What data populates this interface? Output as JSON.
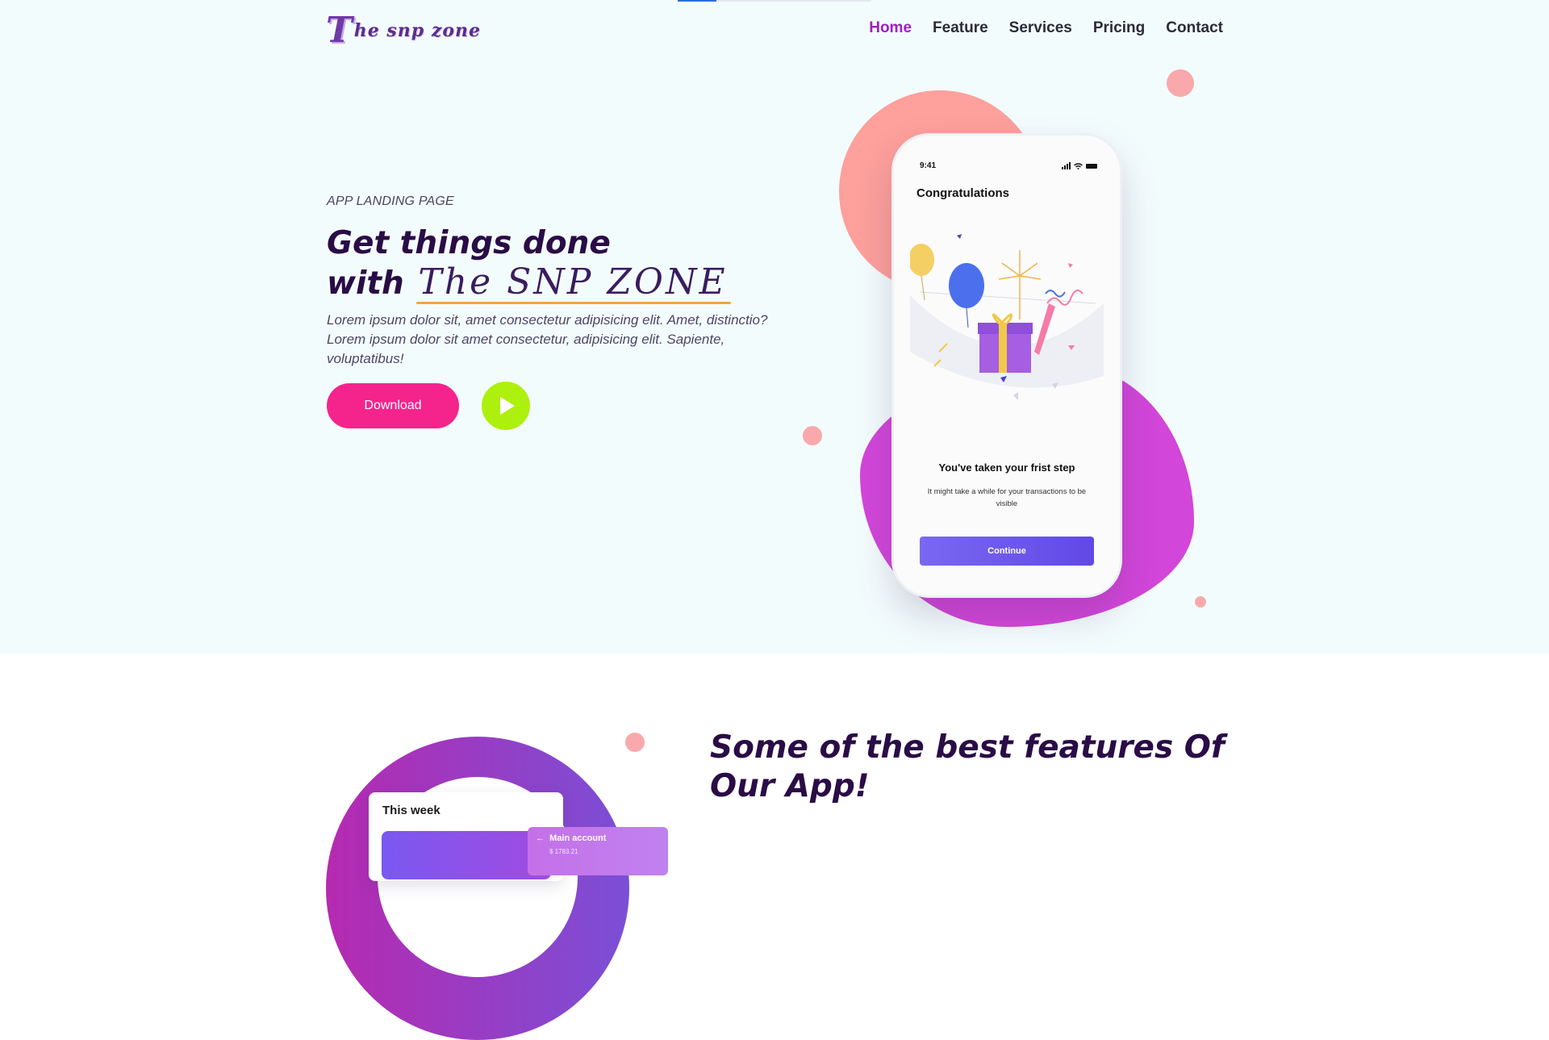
{
  "header": {
    "logo_initial": "T",
    "logo_text": "he snp zone",
    "nav": [
      {
        "label": "Home",
        "active": true
      },
      {
        "label": "Feature",
        "active": false
      },
      {
        "label": "Services",
        "active": false
      },
      {
        "label": "Pricing",
        "active": false
      },
      {
        "label": "Contact",
        "active": false
      }
    ]
  },
  "hero": {
    "eyebrow": "APP LANDING PAGE",
    "headline_line1": "Get things done",
    "headline_line2_prefix": "with",
    "headline_brand": "The SNP ZONE",
    "description": "Lorem ipsum dolor sit, amet consectetur adipisicing elit. Amet, distinctio? Lorem ipsum dolor sit amet consectetur, adipisicing elit. Sapiente, voluptatibus!",
    "download_label": "Download",
    "play_icon": "play-icon"
  },
  "phone": {
    "time": "9:41",
    "title": "Congratulations",
    "step_text": "You've taken your frist step",
    "sub_text": "It might take a while for your transactions to be visible",
    "continue_label": "Continue"
  },
  "features": {
    "title": "Some of the best features Of Our App!",
    "week_label": "This week",
    "account_label": "Main account",
    "account_amount": "$ 1783.21"
  },
  "colors": {
    "accent": "#a21ec4",
    "download": "#f5248c",
    "play": "#aef00d",
    "heading": "#2a0c46",
    "hero_bg": "#f3fcfd",
    "coral": "#fea09b",
    "purple": "#d246d9",
    "button": "#6148e6"
  }
}
